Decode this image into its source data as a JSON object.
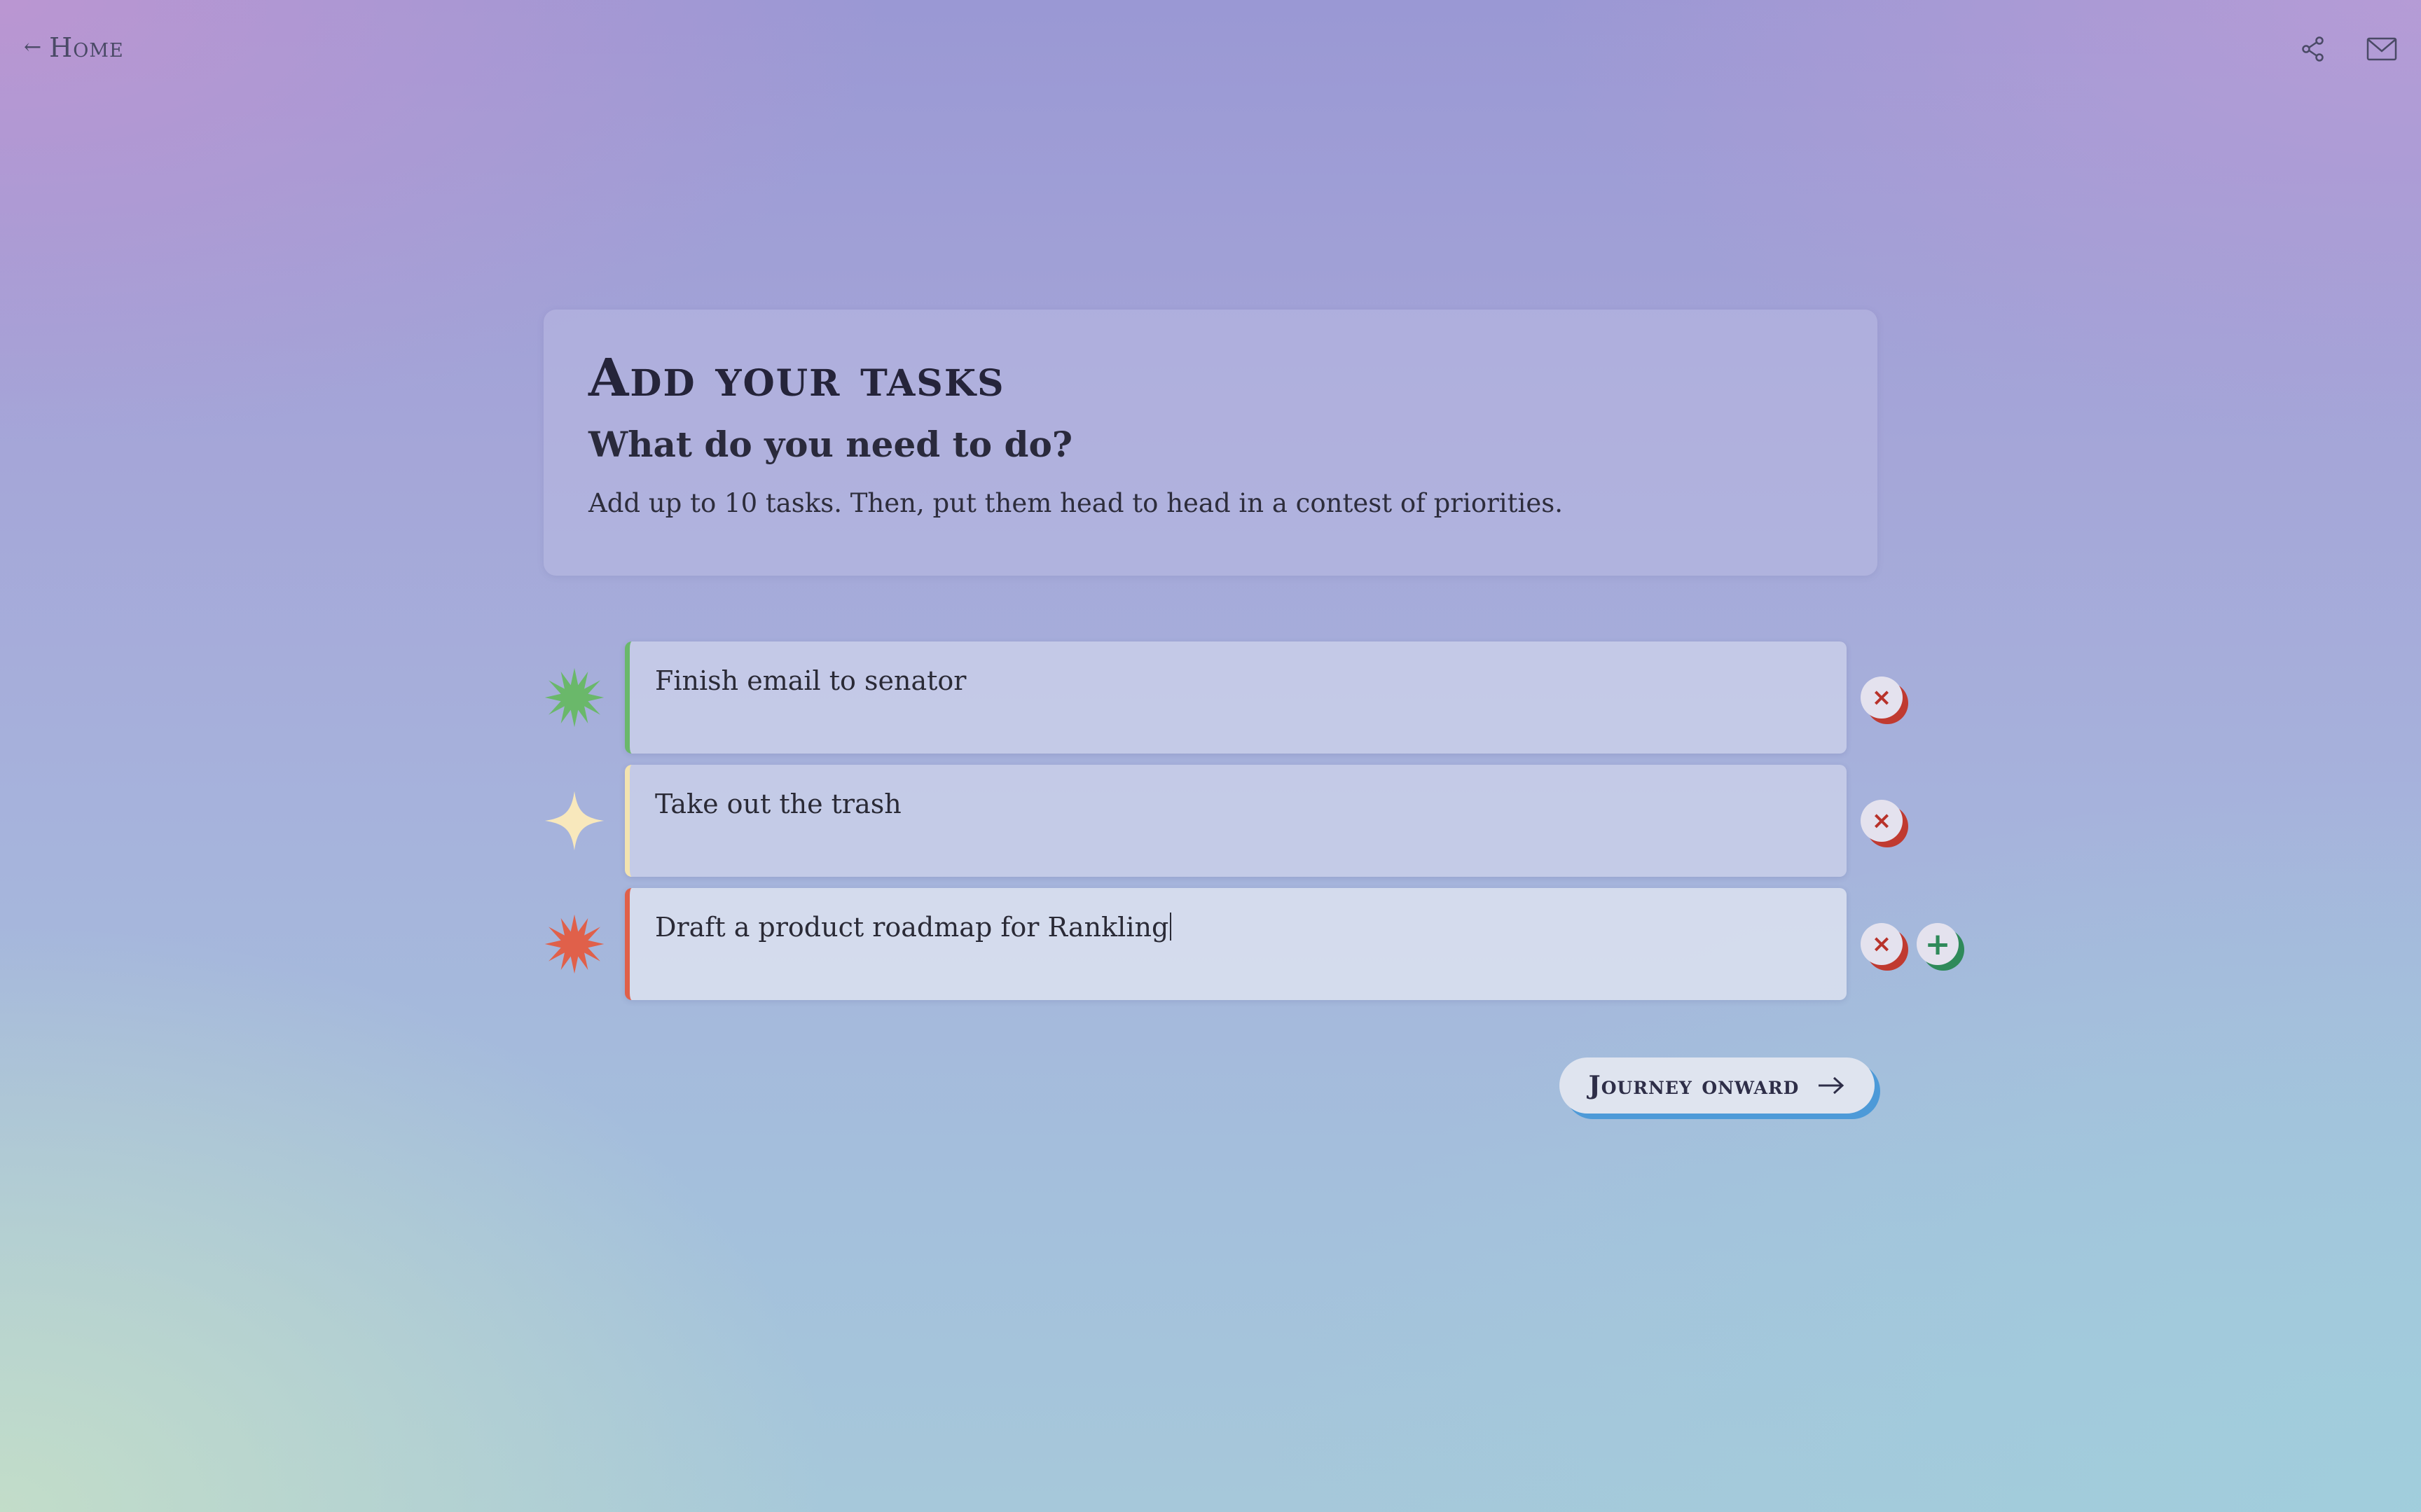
{
  "nav": {
    "back_arrow": "←",
    "home_label": "Home"
  },
  "top_actions": [
    {
      "icon": "share-icon"
    },
    {
      "icon": "mail-icon"
    }
  ],
  "header": {
    "title": "Add your tasks",
    "subtitle": "What do you need to do?",
    "description": "Add up to 10 tasks. Then, put them head to head in a contest of priorities."
  },
  "tasks": [
    {
      "text": "Finish email to senator",
      "accent": "#6ab86a",
      "icon": "green-starburst-icon"
    },
    {
      "text": "Take out the trash",
      "accent": "#f6e4b4",
      "icon": "four-point-star-icon"
    },
    {
      "text": "Draft a product roadmap for Rankling",
      "accent": "#e0604a",
      "icon": "red-starburst-icon"
    }
  ],
  "controls": {
    "remove_symbol": "×",
    "add_symbol": "+"
  },
  "journey_button": {
    "label": "Journey onward"
  },
  "colors": {
    "remove": "#c03a30",
    "add": "#2f8a5a",
    "journey_shadow": "#4d9ad8"
  }
}
